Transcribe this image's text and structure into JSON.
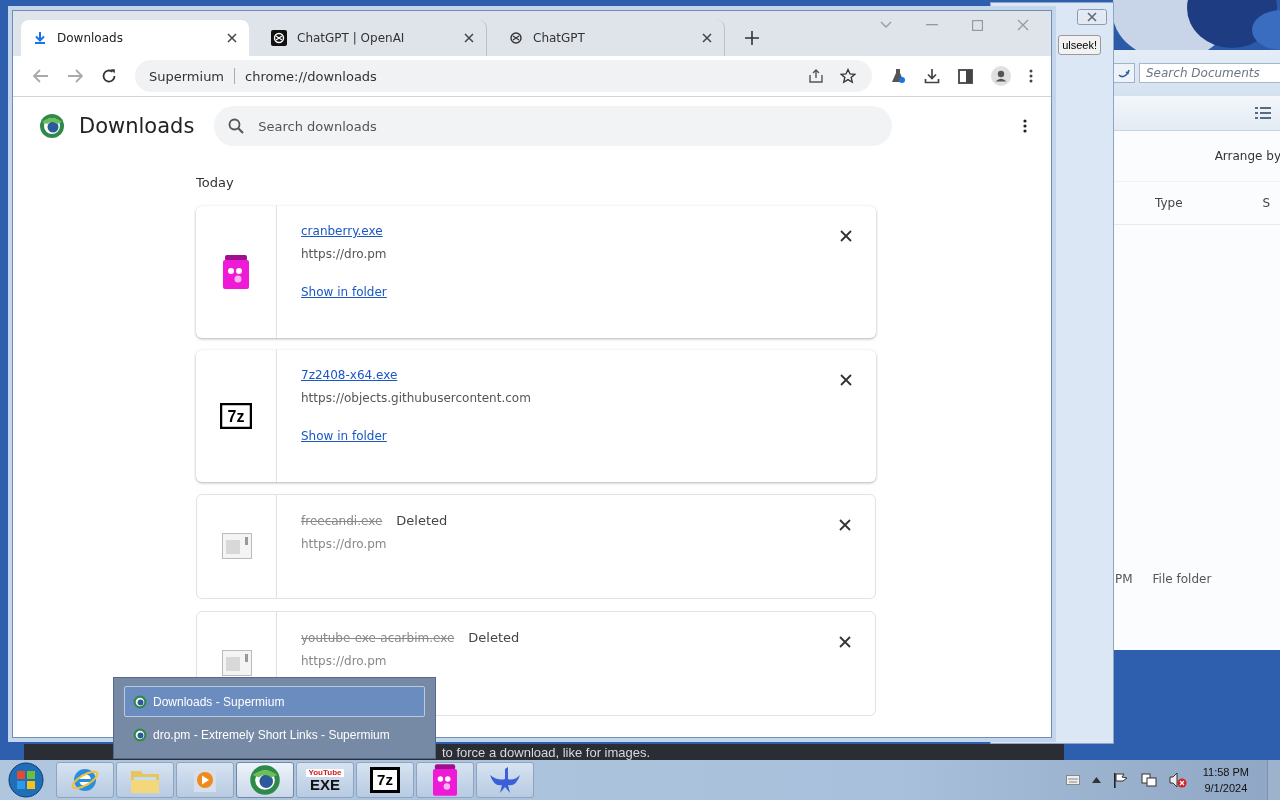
{
  "desktop": {
    "banner_text": "to force a download, like for images."
  },
  "back_window": {
    "button_text": "ulseek!"
  },
  "explorer_window": {
    "search": {
      "placeholder": "Search Documents"
    },
    "arrange_label": "Arrange by",
    "columns": [
      "Type",
      "S"
    ],
    "row": {
      "column_1": "PM",
      "type": "File folder"
    }
  },
  "browser": {
    "tabs": [
      {
        "title": "Downloads",
        "kind": "downloads",
        "selected": true
      },
      {
        "title": "ChatGPT | OpenAI",
        "kind": "openai",
        "selected": false
      },
      {
        "title": "ChatGPT",
        "kind": "chat",
        "selected": false
      }
    ],
    "address_bar": {
      "site_label": "Supermium",
      "url": "chrome://downloads"
    },
    "page": {
      "title": "Downloads",
      "search": {
        "placeholder": "Search downloads"
      },
      "section": "Today",
      "downloads": [
        {
          "name": "cranberry.exe",
          "url": "https://dro.pm",
          "kind": "jar",
          "deleted": false,
          "action": "Show in folder"
        },
        {
          "name": "7z2408-x64.exe",
          "url": "https://objects.githubusercontent.com",
          "kind": "archive",
          "icon_text": "7z",
          "deleted": false,
          "action": "Show in folder"
        },
        {
          "name": "freecandi.exe",
          "status": "Deleted",
          "url": "https://dro.pm",
          "kind": "file",
          "deleted": true
        },
        {
          "name": "youtube-exe-acarbim.exe",
          "status": "Deleted",
          "url": "https://dro.pm",
          "kind": "file",
          "deleted": true
        }
      ]
    }
  },
  "taskbar": {
    "apps": [
      {
        "kind": "ie",
        "active": false
      },
      {
        "kind": "folder",
        "active": false
      },
      {
        "kind": "media",
        "active": false
      },
      {
        "kind": "supermium",
        "active": true
      },
      {
        "kind": "youtube",
        "label_top": "YouTube",
        "label": "EXE",
        "active": false
      },
      {
        "kind": "archive",
        "label": "7z",
        "active": false
      },
      {
        "kind": "cranberry",
        "active": false
      },
      {
        "kind": "bird",
        "active": false
      }
    ],
    "popup": {
      "items": [
        {
          "title": "Downloads - Supermium",
          "selected": true
        },
        {
          "title": "dro.pm - Extremely Short Links - Supermium",
          "selected": false
        }
      ]
    },
    "clock": {
      "time": "11:58 PM",
      "date": "9/1/2024"
    }
  }
}
